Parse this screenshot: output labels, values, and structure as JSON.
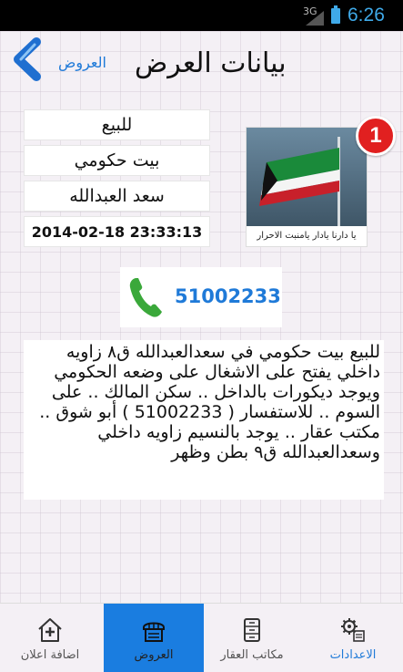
{
  "status_bar": {
    "network": "3G",
    "time": "6:26"
  },
  "header": {
    "title": "بيانات العرض",
    "back_label": "العروض"
  },
  "listing": {
    "type": "للبيع",
    "category": "بيت حكومي",
    "location": "سعد العبدالله",
    "date": "2014-02-18 23:33:13",
    "image_caption": "يا دارنا يادار يامنبت الاحرار",
    "badge_count": "1",
    "phone": "51002233",
    "description": "للبيع بيت حكومي في سعدالعبدالله ق٨ زاويه داخلي يفتح على الاشغال على وضعه الحكومي ويوجد ديكورات بالداخل .. سكن المالك .. على السوم .. للاستفسار ( 51002233 ) أبو شوق .. مكتب عقار .. يوجد بالنسيم زاويه داخلي وسعدالعبدالله ق٩ بطن وظهر"
  },
  "bottom_nav": {
    "add_ad": "اضافة اعلان",
    "offers": "العروض",
    "agencies": "مكاتب العقار",
    "settings": "الاعدادات"
  },
  "colors": {
    "accent": "#1a7de0",
    "badge": "#e12020",
    "phone_icon": "#3aa83a"
  }
}
